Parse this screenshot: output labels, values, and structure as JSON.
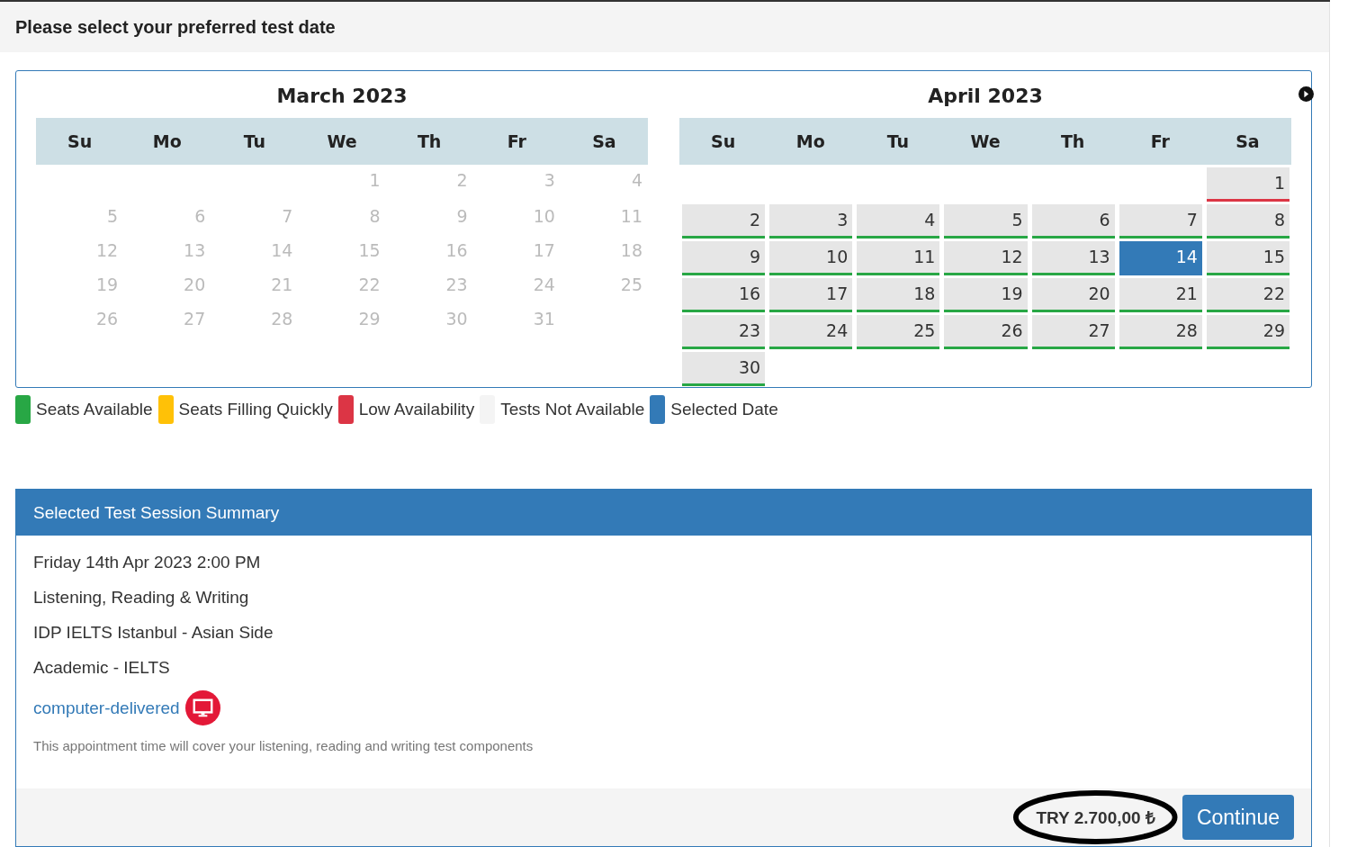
{
  "header": {
    "title": "Please select your preferred test date"
  },
  "calendars": [
    {
      "title": "March 2023",
      "has_next": false,
      "weekdays": [
        "Su",
        "Mo",
        "Tu",
        "We",
        "Th",
        "Fr",
        "Sa"
      ],
      "weeks": [
        [
          {
            "kind": "empty"
          },
          {
            "kind": "empty"
          },
          {
            "kind": "empty"
          },
          {
            "kind": "day",
            "day": "1",
            "disabled": true,
            "selected": false
          },
          {
            "kind": "day",
            "day": "2",
            "disabled": true,
            "selected": false
          },
          {
            "kind": "day",
            "day": "3",
            "disabled": true,
            "selected": false
          },
          {
            "kind": "day",
            "day": "4",
            "disabled": true,
            "selected": false
          }
        ],
        [
          {
            "kind": "day",
            "day": "5",
            "disabled": true,
            "selected": false
          },
          {
            "kind": "day",
            "day": "6",
            "disabled": true,
            "selected": false
          },
          {
            "kind": "day",
            "day": "7",
            "disabled": true,
            "selected": false
          },
          {
            "kind": "day",
            "day": "8",
            "disabled": true,
            "selected": false
          },
          {
            "kind": "day",
            "day": "9",
            "disabled": true,
            "selected": false
          },
          {
            "kind": "day",
            "day": "10",
            "disabled": true,
            "selected": false
          },
          {
            "kind": "day",
            "day": "11",
            "disabled": true,
            "selected": false
          }
        ],
        [
          {
            "kind": "day",
            "day": "12",
            "disabled": true,
            "selected": false
          },
          {
            "kind": "day",
            "day": "13",
            "disabled": true,
            "selected": false
          },
          {
            "kind": "day",
            "day": "14",
            "disabled": true,
            "selected": false
          },
          {
            "kind": "day",
            "day": "15",
            "disabled": true,
            "selected": false
          },
          {
            "kind": "day",
            "day": "16",
            "disabled": true,
            "selected": false
          },
          {
            "kind": "day",
            "day": "17",
            "disabled": true,
            "selected": false
          },
          {
            "kind": "day",
            "day": "18",
            "disabled": true,
            "selected": false
          }
        ],
        [
          {
            "kind": "day",
            "day": "19",
            "disabled": true,
            "selected": false
          },
          {
            "kind": "day",
            "day": "20",
            "disabled": true,
            "selected": false
          },
          {
            "kind": "day",
            "day": "21",
            "disabled": true,
            "selected": false
          },
          {
            "kind": "day",
            "day": "22",
            "disabled": true,
            "selected": false
          },
          {
            "kind": "day",
            "day": "23",
            "disabled": true,
            "selected": false
          },
          {
            "kind": "day",
            "day": "24",
            "disabled": true,
            "selected": false
          },
          {
            "kind": "day",
            "day": "25",
            "disabled": true,
            "selected": false
          }
        ],
        [
          {
            "kind": "day",
            "day": "26",
            "disabled": true,
            "selected": false
          },
          {
            "kind": "day",
            "day": "27",
            "disabled": true,
            "selected": false
          },
          {
            "kind": "day",
            "day": "28",
            "disabled": true,
            "selected": false
          },
          {
            "kind": "day",
            "day": "29",
            "disabled": true,
            "selected": false
          },
          {
            "kind": "day",
            "day": "30",
            "disabled": true,
            "selected": false
          },
          {
            "kind": "day",
            "day": "31",
            "disabled": true,
            "selected": false
          },
          {
            "kind": "empty"
          }
        ]
      ]
    },
    {
      "title": "April 2023",
      "has_next": true,
      "weekdays": [
        "Su",
        "Mo",
        "Tu",
        "We",
        "Th",
        "Fr",
        "Sa"
      ],
      "weeks": [
        [
          {
            "kind": "empty"
          },
          {
            "kind": "empty"
          },
          {
            "kind": "empty"
          },
          {
            "kind": "empty"
          },
          {
            "kind": "empty"
          },
          {
            "kind": "empty"
          },
          {
            "kind": "day",
            "day": "1",
            "disabled": false,
            "selected": false,
            "color": "#dc3545"
          }
        ],
        [
          {
            "kind": "day",
            "day": "2",
            "disabled": false,
            "selected": false,
            "color": "#28a745"
          },
          {
            "kind": "day",
            "day": "3",
            "disabled": false,
            "selected": false,
            "color": "#28a745"
          },
          {
            "kind": "day",
            "day": "4",
            "disabled": false,
            "selected": false,
            "color": "#28a745"
          },
          {
            "kind": "day",
            "day": "5",
            "disabled": false,
            "selected": false,
            "color": "#28a745"
          },
          {
            "kind": "day",
            "day": "6",
            "disabled": false,
            "selected": false,
            "color": "#28a745"
          },
          {
            "kind": "day",
            "day": "7",
            "disabled": false,
            "selected": false,
            "color": "#28a745"
          },
          {
            "kind": "day",
            "day": "8",
            "disabled": false,
            "selected": false,
            "color": "#28a745"
          }
        ],
        [
          {
            "kind": "day",
            "day": "9",
            "disabled": false,
            "selected": false,
            "color": "#28a745"
          },
          {
            "kind": "day",
            "day": "10",
            "disabled": false,
            "selected": false,
            "color": "#28a745"
          },
          {
            "kind": "day",
            "day": "11",
            "disabled": false,
            "selected": false,
            "color": "#28a745"
          },
          {
            "kind": "day",
            "day": "12",
            "disabled": false,
            "selected": false,
            "color": "#28a745"
          },
          {
            "kind": "day",
            "day": "13",
            "disabled": false,
            "selected": false,
            "color": "#28a745"
          },
          {
            "kind": "day",
            "day": "14",
            "disabled": false,
            "selected": true,
            "color": "#337ab7"
          },
          {
            "kind": "day",
            "day": "15",
            "disabled": false,
            "selected": false,
            "color": "#28a745"
          }
        ],
        [
          {
            "kind": "day",
            "day": "16",
            "disabled": false,
            "selected": false,
            "color": "#28a745"
          },
          {
            "kind": "day",
            "day": "17",
            "disabled": false,
            "selected": false,
            "color": "#28a745"
          },
          {
            "kind": "day",
            "day": "18",
            "disabled": false,
            "selected": false,
            "color": "#28a745"
          },
          {
            "kind": "day",
            "day": "19",
            "disabled": false,
            "selected": false,
            "color": "#28a745"
          },
          {
            "kind": "day",
            "day": "20",
            "disabled": false,
            "selected": false,
            "color": "#28a745"
          },
          {
            "kind": "day",
            "day": "21",
            "disabled": false,
            "selected": false,
            "color": "#28a745"
          },
          {
            "kind": "day",
            "day": "22",
            "disabled": false,
            "selected": false,
            "color": "#28a745"
          }
        ],
        [
          {
            "kind": "day",
            "day": "23",
            "disabled": false,
            "selected": false,
            "color": "#28a745"
          },
          {
            "kind": "day",
            "day": "24",
            "disabled": false,
            "selected": false,
            "color": "#28a745"
          },
          {
            "kind": "day",
            "day": "25",
            "disabled": false,
            "selected": false,
            "color": "#28a745"
          },
          {
            "kind": "day",
            "day": "26",
            "disabled": false,
            "selected": false,
            "color": "#28a745"
          },
          {
            "kind": "day",
            "day": "27",
            "disabled": false,
            "selected": false,
            "color": "#28a745"
          },
          {
            "kind": "day",
            "day": "28",
            "disabled": false,
            "selected": false,
            "color": "#28a745"
          },
          {
            "kind": "day",
            "day": "29",
            "disabled": false,
            "selected": false,
            "color": "#28a745"
          }
        ],
        [
          {
            "kind": "day",
            "day": "30",
            "disabled": false,
            "selected": false,
            "color": "#28a745"
          },
          {
            "kind": "empty"
          },
          {
            "kind": "empty"
          },
          {
            "kind": "empty"
          },
          {
            "kind": "empty"
          },
          {
            "kind": "empty"
          },
          {
            "kind": "empty"
          }
        ]
      ]
    }
  ],
  "legend": [
    {
      "label": "Seats Available",
      "color": "#28a745"
    },
    {
      "label": "Seats Filling Quickly",
      "color": "#ffc107"
    },
    {
      "label": "Low Availability",
      "color": "#dc3545"
    },
    {
      "label": "Tests Not Available",
      "color": "#f4f4f4"
    },
    {
      "label": "Selected Date",
      "color": "#337ab7"
    }
  ],
  "summary": {
    "title": "Selected Test Session Summary",
    "lines": [
      "Friday 14th Apr 2023 2:00 PM",
      "Listening, Reading & Writing",
      "IDP IELTS Istanbul - Asian Side",
      "Academic - IELTS"
    ],
    "delivery_link": "computer-delivered",
    "note": "This appointment time will cover your listening, reading and writing test components",
    "price": "TRY 2.700,00 ₺",
    "continue_button": "Continue"
  }
}
